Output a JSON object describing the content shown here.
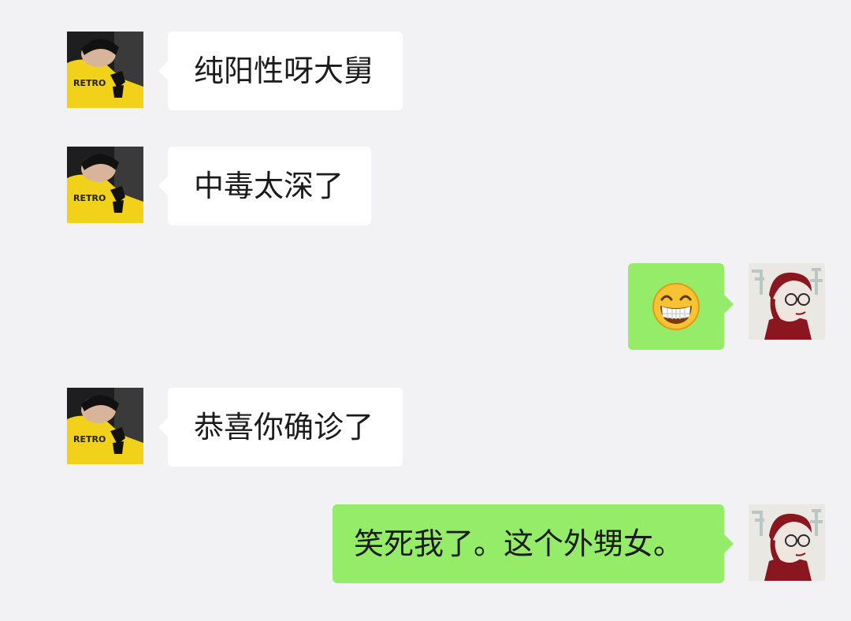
{
  "chat": {
    "messages": [
      {
        "sender": "other",
        "text": "纯阳性呀大舅"
      },
      {
        "sender": "other",
        "text": "中毒太深了"
      },
      {
        "sender": "self",
        "text": "",
        "emoji": "grinning-face-emoji"
      },
      {
        "sender": "other",
        "text": "恭喜你确诊了"
      },
      {
        "sender": "self",
        "text": "笑死我了。这个外甥女。"
      }
    ]
  },
  "avatars": {
    "other": {
      "shirt_text": "RETRO"
    }
  },
  "colors": {
    "background": "#f2f2f4",
    "incoming_bubble": "#ffffff",
    "outgoing_bubble": "#95ec69",
    "text": "#1b1b1b"
  }
}
